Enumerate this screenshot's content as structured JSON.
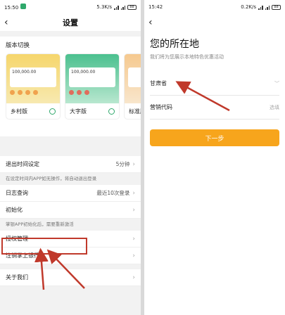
{
  "left": {
    "status": {
      "time": "15:50",
      "net": "5.3K/s",
      "icons": "⏰ 📶 📶 ≋",
      "battery": "88"
    },
    "nav": {
      "back": "‹",
      "title": "设置"
    },
    "version": {
      "section_title": "版本切换",
      "options": [
        {
          "label": "乡村版",
          "amount": "100,000.00"
        },
        {
          "label": "大字版",
          "amount": "100,000.00"
        },
        {
          "label": "标准版"
        }
      ]
    },
    "items": {
      "timeout_label": "退出时间设定",
      "timeout_value": "5分钟",
      "timeout_note": "在设定时间内APP如无操作，将自动退出登录",
      "log_label": "日志查询",
      "log_value": "最近10次登录",
      "init_label": "初始化",
      "init_note": "掌银APP初始化后，需要重新激活",
      "auth_label": "授权管理",
      "cancel_label": "注销掌上银行",
      "about_label": "关于我们"
    },
    "chevron": "›"
  },
  "right": {
    "status": {
      "time": "15:42",
      "net": "0.2K/s",
      "icons": "⏰ 📶 📶 ≋",
      "battery": "88"
    },
    "nav": {
      "back": "‹"
    },
    "title": "您的所在地",
    "subtitle": "我们将为您展示本地特色优惠活动",
    "province_value": "甘肃省",
    "province_chevron": "﹀",
    "code_label": "营销代码",
    "code_hint": "选填",
    "next_label": "下一步"
  },
  "colors": {
    "accent": "#f7a51c",
    "brand": "#2fa86b",
    "annotation": "#c0392b"
  }
}
